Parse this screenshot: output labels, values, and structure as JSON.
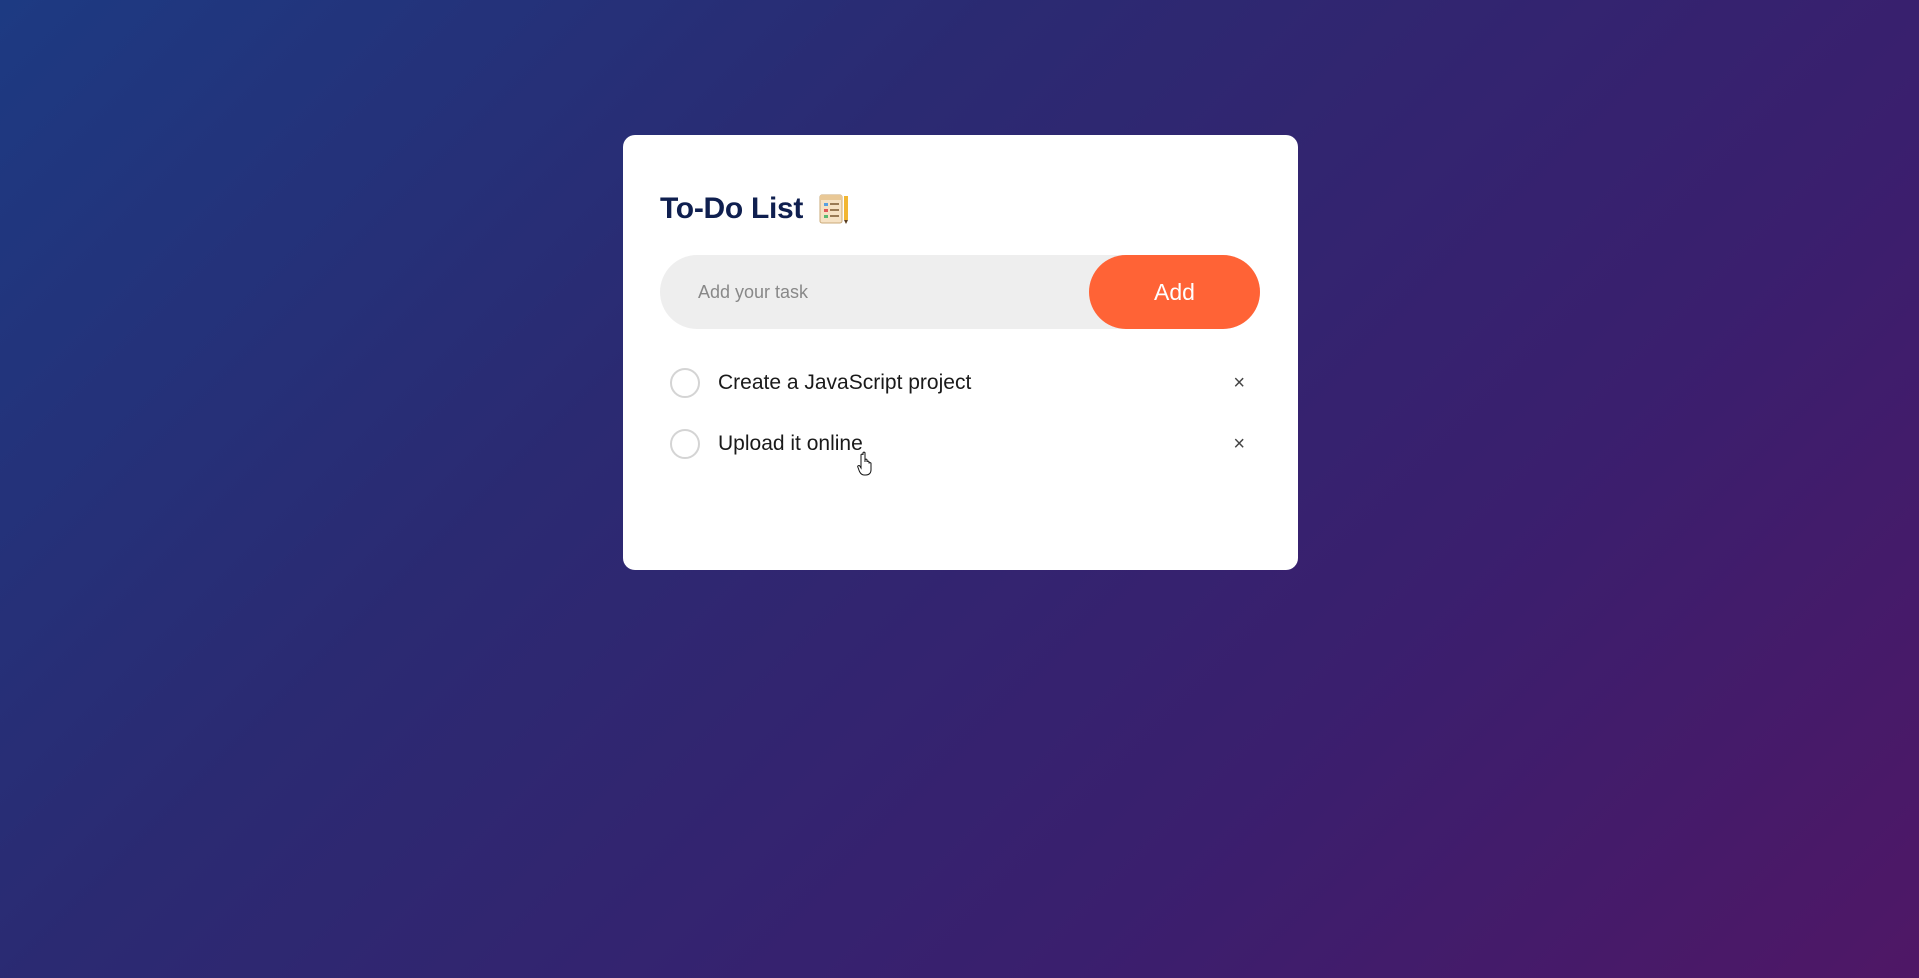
{
  "app": {
    "title": "To-Do List",
    "title_icon": "notepad-checklist-icon"
  },
  "input": {
    "placeholder": "Add your task",
    "value": "",
    "add_label": "Add"
  },
  "tasks": [
    {
      "text": "Create a JavaScript project",
      "completed": false,
      "delete_label": "×"
    },
    {
      "text": "Upload it online",
      "completed": false,
      "delete_label": "×"
    }
  ],
  "colors": {
    "accent": "#ff6336",
    "title": "#0f1f4f",
    "card": "#ffffff",
    "input_bg": "#eeeeee"
  },
  "cursor": "hand-pointer-icon"
}
